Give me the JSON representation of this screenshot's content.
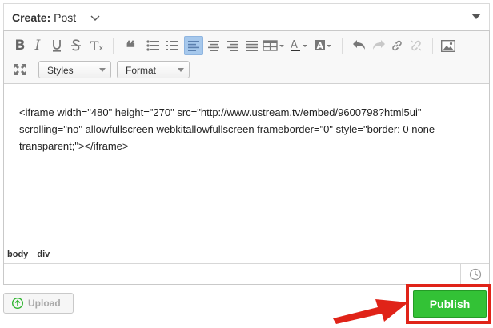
{
  "header": {
    "label": "Create:",
    "type": "Post"
  },
  "toolbar": {
    "buttons": [
      "bold",
      "italic",
      "underline",
      "strikethrough",
      "remove-format",
      "blockquote",
      "bulleted-list",
      "numbered-list",
      "align-left",
      "align-center",
      "align-right",
      "align-justify",
      "table",
      "text-color",
      "background-color",
      "undo",
      "redo",
      "link",
      "unlink",
      "image",
      "maximize"
    ],
    "active": "align-left",
    "styles_label": "Styles",
    "format_label": "Format"
  },
  "content": {
    "text": "<iframe width=\"480\" height=\"270\" src=\"http://www.ustream.tv/embed/9600798?html5ui\" scrolling=\"no\" allowfullscreen webkitallowfullscreen frameborder=\"0\" style=\"border: 0 none transparent;\"></iframe>"
  },
  "path": {
    "items": [
      "body",
      "div"
    ]
  },
  "actions": {
    "upload_label": "Upload",
    "publish_label": "Publish"
  },
  "colors": {
    "publish": "#33c236",
    "highlight": "#e02318",
    "active_button": "#a6c8ec"
  }
}
